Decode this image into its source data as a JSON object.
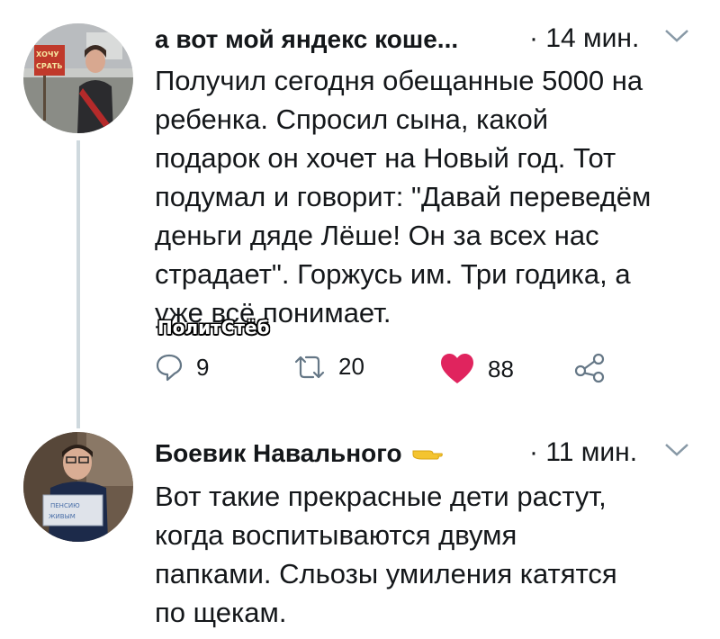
{
  "tweets": [
    {
      "author": "а вот мой яндекс коше...",
      "time": "· 14 мин.",
      "lines": [
        "Получил сегодня обещанные 5000 на",
        "ребенка. Спросил сына, какой",
        "подарок он хочет на Новый год. Тот",
        "подумал и говорит: \"Давай переведём",
        "деньги дяде Лёше! Он за всех нас",
        "страдает\". Горжусь им. Три годика, а",
        "уже всё понимает."
      ],
      "avatar_sign": "ХОЧУ СРАТЬ",
      "actions": {
        "replies": "9",
        "retweets": "20",
        "likes": "88"
      }
    },
    {
      "author": "Боевик Навального",
      "time": "· 11 мин.",
      "lines": [
        "Вот такие прекрасные дети растут,",
        "когда воспитываются двумя",
        "папками. Сльозы умиления катятся",
        "по щекам."
      ]
    }
  ],
  "watermark": "ПолитСтёб",
  "colors": {
    "like": "#e0245e",
    "icon": "#657786",
    "thread_line": "#cfd9de"
  },
  "icons": [
    "reply-icon",
    "retweet-icon",
    "like-icon",
    "share-icon",
    "chevron-down-icon",
    "hand-emoji-icon"
  ]
}
